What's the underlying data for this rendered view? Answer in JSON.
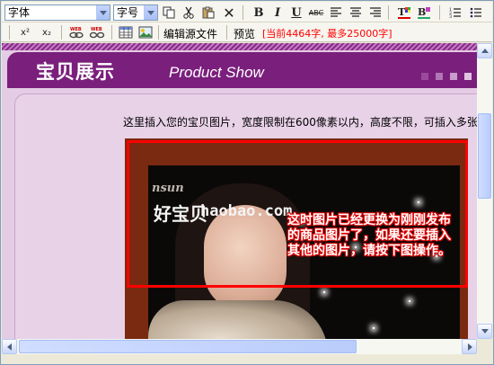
{
  "toolbar": {
    "font_select": "字体",
    "size_select": "字号",
    "bold": "B",
    "italic": "I",
    "underline": "U",
    "strike": "ABC",
    "superscript": "x²",
    "subscript": "x₂",
    "edit_source": "编辑源文件",
    "preview": "预览",
    "counter": "[当前4464字, 最多25000字]"
  },
  "page": {
    "banner_title": "宝贝展示",
    "banner_subtitle": "Product Show",
    "notice": "这里插入您的宝贝图片，宽度限制在600像素以内，高度不限，可插入多张",
    "watermark_top": "nsun",
    "watermark_brand": "好宝贝",
    "watermark_site": "haobao.com",
    "annotation": "这时图片已经更换为刚刚发布的商品图片了，如果还要插入其他的图片，请按下图操作。"
  },
  "colors": {
    "banner": "#7a1f7c",
    "content_bg": "#e8d2e8",
    "annotation_outline": "#e00000",
    "highlight_rect": "#ff0000",
    "counter_text": "#ff0000"
  },
  "icons": [
    "copy-icon",
    "cut-icon",
    "paste-icon",
    "delete-icon",
    "align-left-icon",
    "align-center-icon",
    "align-right-icon",
    "text-color-icon",
    "background-color-icon",
    "ordered-list-icon",
    "link-icon",
    "unlink-icon",
    "table-icon",
    "image-icon"
  ]
}
